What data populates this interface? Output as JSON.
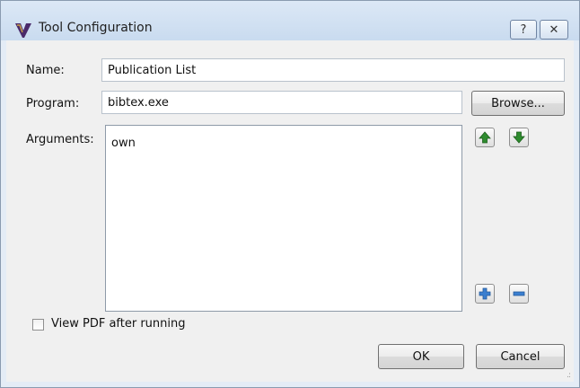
{
  "window": {
    "title": "Tool Configuration",
    "help_label": "?",
    "close_label": "✕"
  },
  "form": {
    "name_label": "Name:",
    "name_value": "Publication List",
    "program_label": "Program:",
    "program_value": "bibtex.exe",
    "browse_label": "Browse...",
    "arguments_label": "Arguments:",
    "arguments_value": "own"
  },
  "options": {
    "view_pdf_label": "View PDF after running",
    "view_pdf_checked": false
  },
  "buttons": {
    "ok_label": "OK",
    "cancel_label": "Cancel"
  },
  "colors": {
    "titlebar": "#c9dbef",
    "accent_green": "#2e8b2e",
    "accent_blue": "#3b7fd0"
  }
}
